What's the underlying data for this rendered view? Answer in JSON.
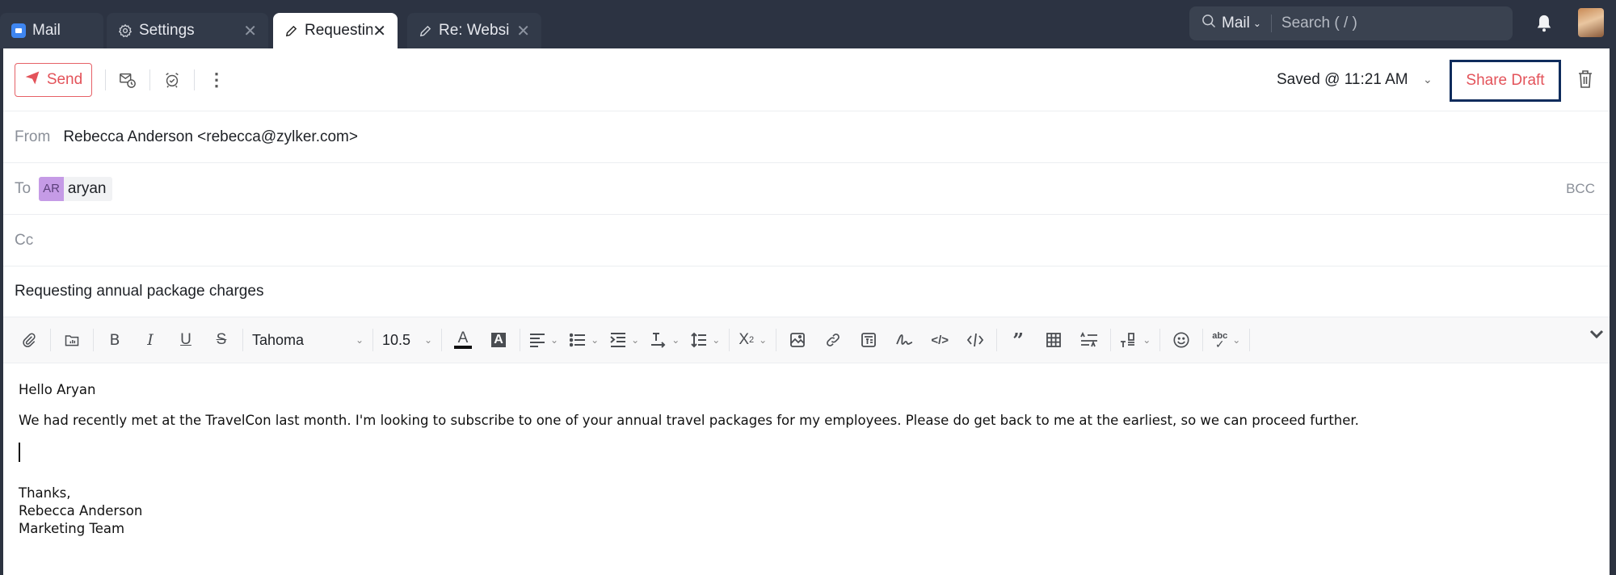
{
  "tabs": [
    {
      "label": "Mail",
      "icon": "mail-app-icon",
      "closable": false,
      "active": false
    },
    {
      "label": "Settings",
      "icon": "gear-icon",
      "closable": true,
      "active": false
    },
    {
      "label": "Requestin",
      "icon": "pencil-icon",
      "closable": true,
      "active": true
    },
    {
      "label": "Re: Websi",
      "icon": "pencil-icon",
      "closable": true,
      "active": false
    }
  ],
  "search": {
    "scope": "Mail",
    "placeholder": "Search ( / )"
  },
  "toolbar": {
    "send_label": "Send",
    "saved_status": "Saved @ 11:21 AM",
    "share_draft_label": "Share Draft"
  },
  "compose": {
    "from_label": "From",
    "from_value": "Rebecca Anderson <rebecca@zylker.com>",
    "to_label": "To",
    "to_recipient": {
      "initials": "AR",
      "name": "aryan"
    },
    "bcc_label": "BCC",
    "cc_label": "Cc",
    "subject": "Requesting annual package charges"
  },
  "format": {
    "font": "Tahoma",
    "size": "10.5"
  },
  "body": {
    "greeting": "Hello Aryan",
    "paragraph": "We had recently met at the TravelCon last month. I'm looking to subscribe to one of your annual travel packages for my employees. Please do get back to me at the earliest, so we can proceed further.",
    "signoff": "Thanks,",
    "sig_name": "Rebecca Anderson",
    "sig_team": "Marketing Team"
  },
  "colors": {
    "accent_red": "#e3535a",
    "focus_border": "#0f2c5c",
    "chip_purple": "#c59be6"
  }
}
